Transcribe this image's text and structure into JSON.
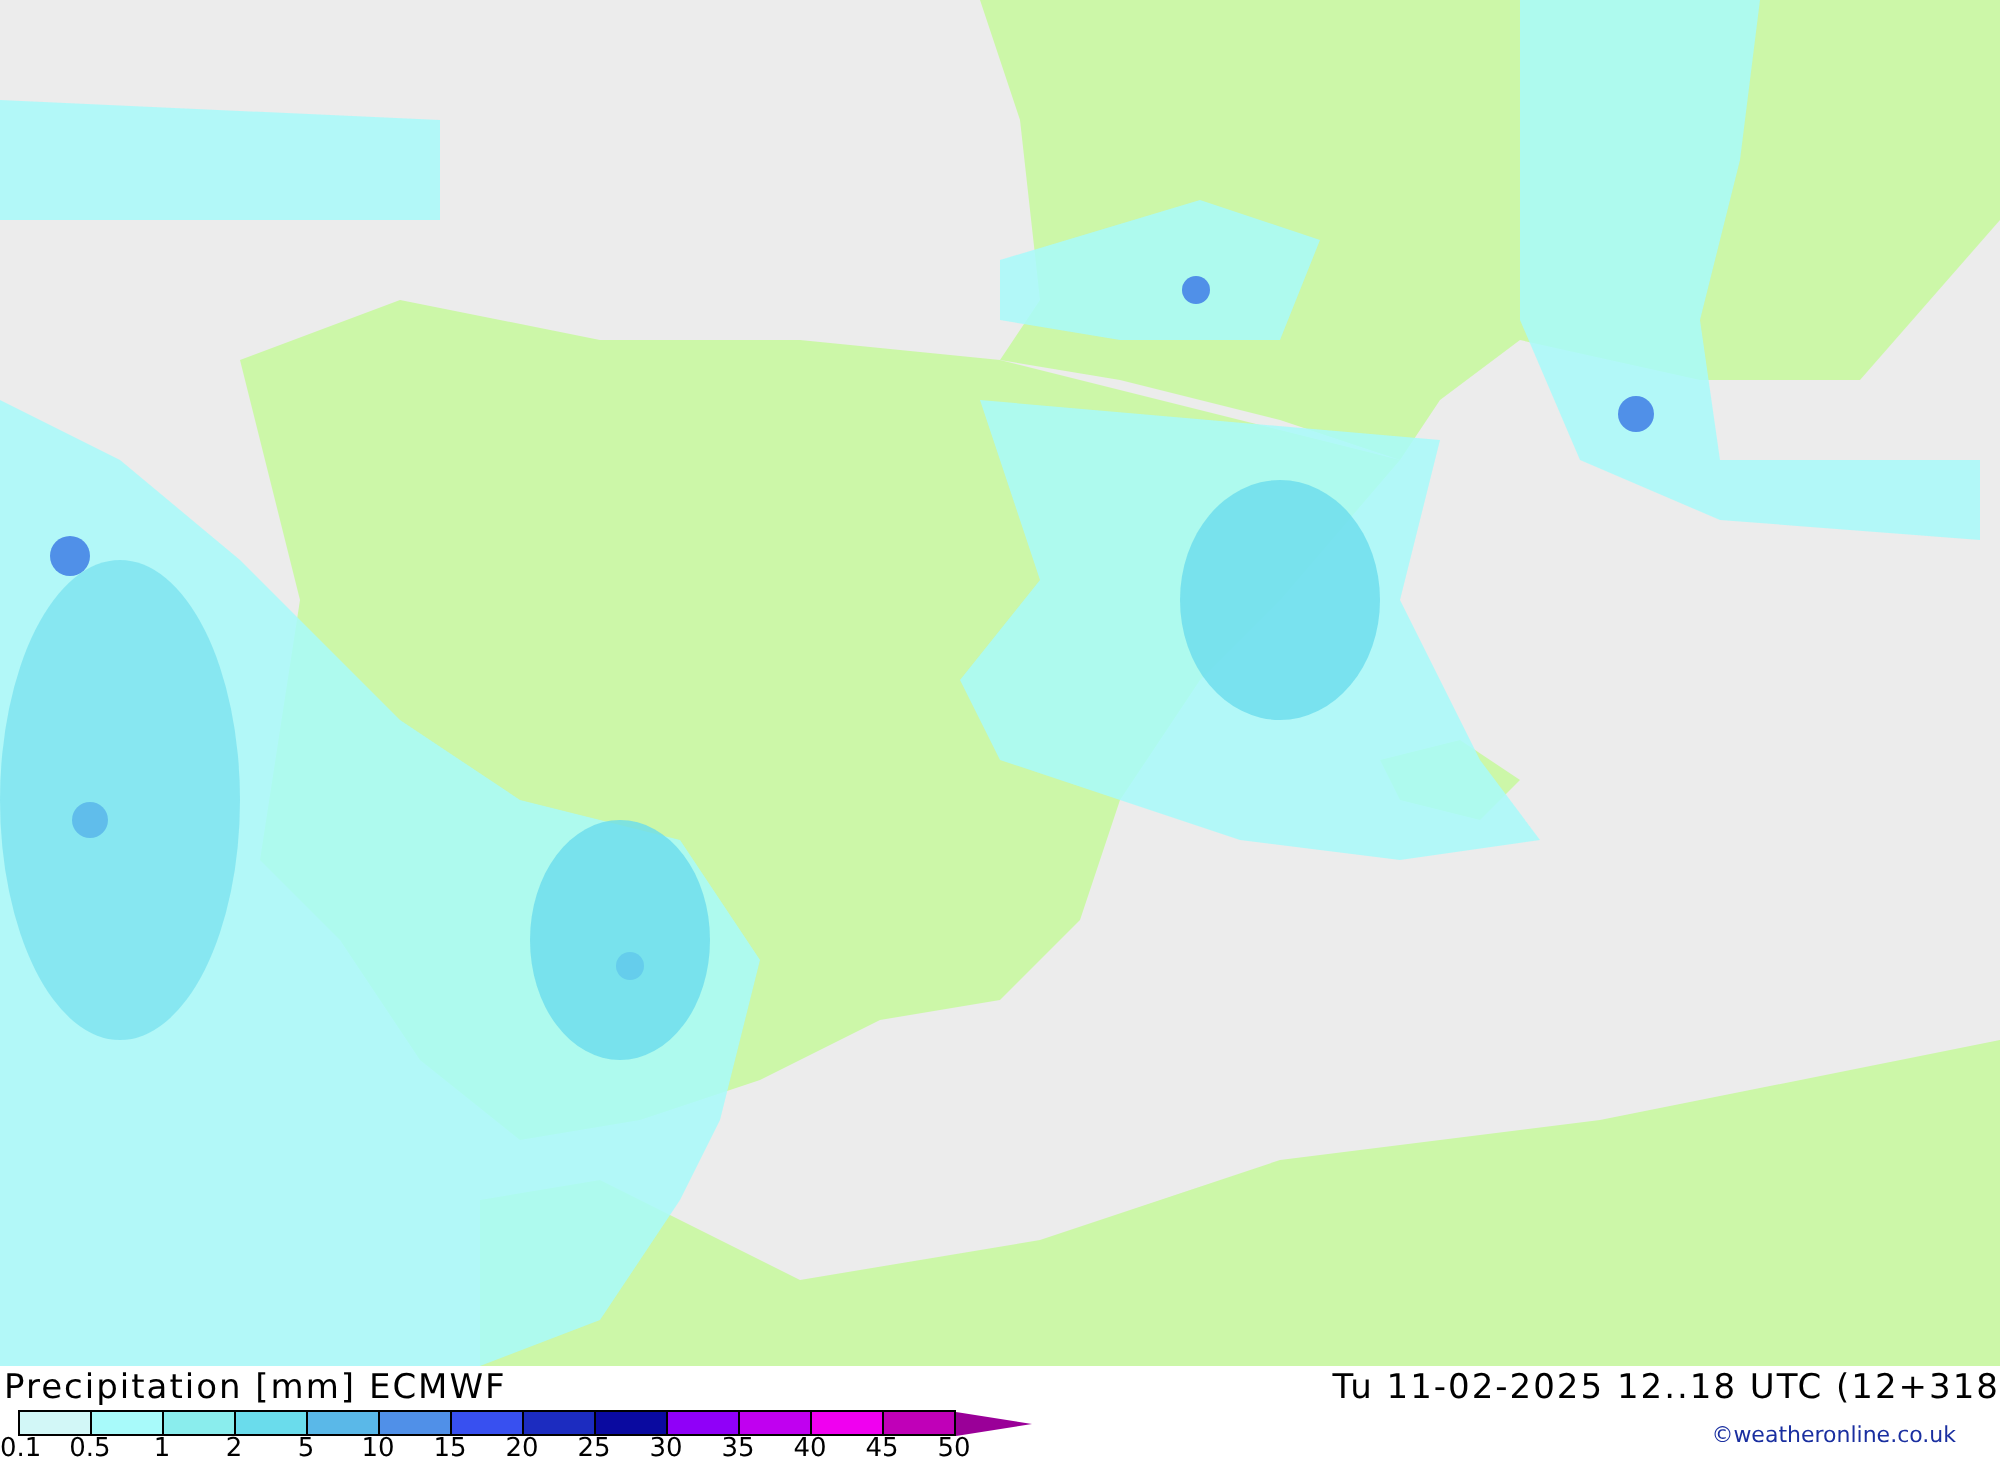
{
  "title": "Precipitation [mm] ECMWF",
  "valid_time": "Tu 11-02-2025 12..18 UTC (12+318",
  "legend": [
    {
      "label": "0.1",
      "color": "#d2f7f7"
    },
    {
      "label": "0.5",
      "color": "#a8fafa"
    },
    {
      "label": "1",
      "color": "#8aeded"
    },
    {
      "label": "2",
      "color": "#6adcec"
    },
    {
      "label": "5",
      "color": "#5ab8e8"
    },
    {
      "label": "10",
      "color": "#5090e8"
    },
    {
      "label": "15",
      "color": "#3850f0"
    },
    {
      "label": "20",
      "color": "#1c2cc0"
    },
    {
      "label": "25",
      "color": "#0a0aa0"
    },
    {
      "label": "30",
      "color": "#9000f8"
    },
    {
      "label": "35",
      "color": "#c000f0"
    },
    {
      "label": "40",
      "color": "#f000f0"
    },
    {
      "label": "45",
      "color": "#c000b8"
    },
    {
      "label": "50",
      "color": "#9a0098"
    }
  ],
  "credit": "©weatheronline.co.uk"
}
